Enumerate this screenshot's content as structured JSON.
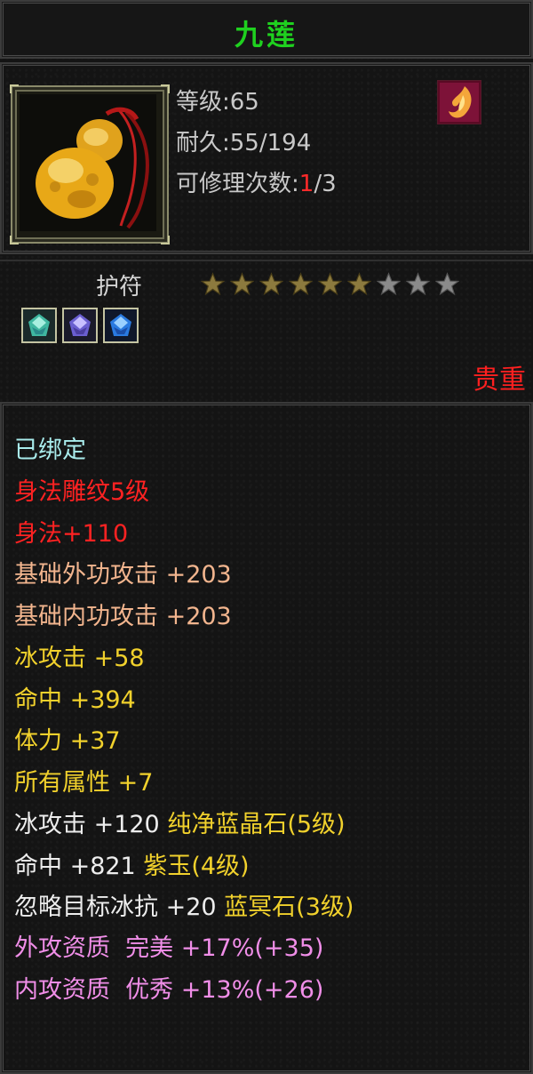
{
  "item": {
    "name": "九莲",
    "level": "等级:65",
    "durability": "耐久:55/194",
    "repair_prefix": "可修理次数:",
    "repair_current": "1",
    "repair_suffix": "/3",
    "type": "护符",
    "rarity": "贵重",
    "star_rating": {
      "filled": 6,
      "total": 9
    },
    "gems": [
      "green-gem-icon",
      "purple-gem-icon",
      "blue-gem-icon"
    ]
  },
  "attributes": [
    {
      "text": "已绑定",
      "color": "#a9ecec"
    },
    {
      "text": "身法雕纹5级",
      "color": "#ff2222"
    },
    {
      "text": "身法+110",
      "color": "#ff2222"
    },
    {
      "text": "基础外功攻击 +203",
      "color": "#f2b58e"
    },
    {
      "text": "基础内功攻击 +203",
      "color": "#f2b58e"
    },
    {
      "text": "冰攻击 +58",
      "color": "#f1d12c"
    },
    {
      "text": "命中 +394",
      "color": "#f1d12c"
    },
    {
      "text": "体力 +37",
      "color": "#f1d12c"
    },
    {
      "text": "所有属性 +7",
      "color": "#f1d12c"
    }
  ],
  "gem_attributes": [
    {
      "stat": "冰攻击 +120",
      "gem": "纯净蓝晶石(5级)"
    },
    {
      "stat": "命中 +821",
      "gem": "紫玉(4级)"
    },
    {
      "stat": "忽略目标冰抗 +20",
      "gem": "蓝冥石(3级)"
    }
  ],
  "qualities": [
    {
      "text": "外攻资质  完美 +17%(+35)"
    },
    {
      "text": "内攻资质  优秀 +13%(+26)"
    }
  ]
}
